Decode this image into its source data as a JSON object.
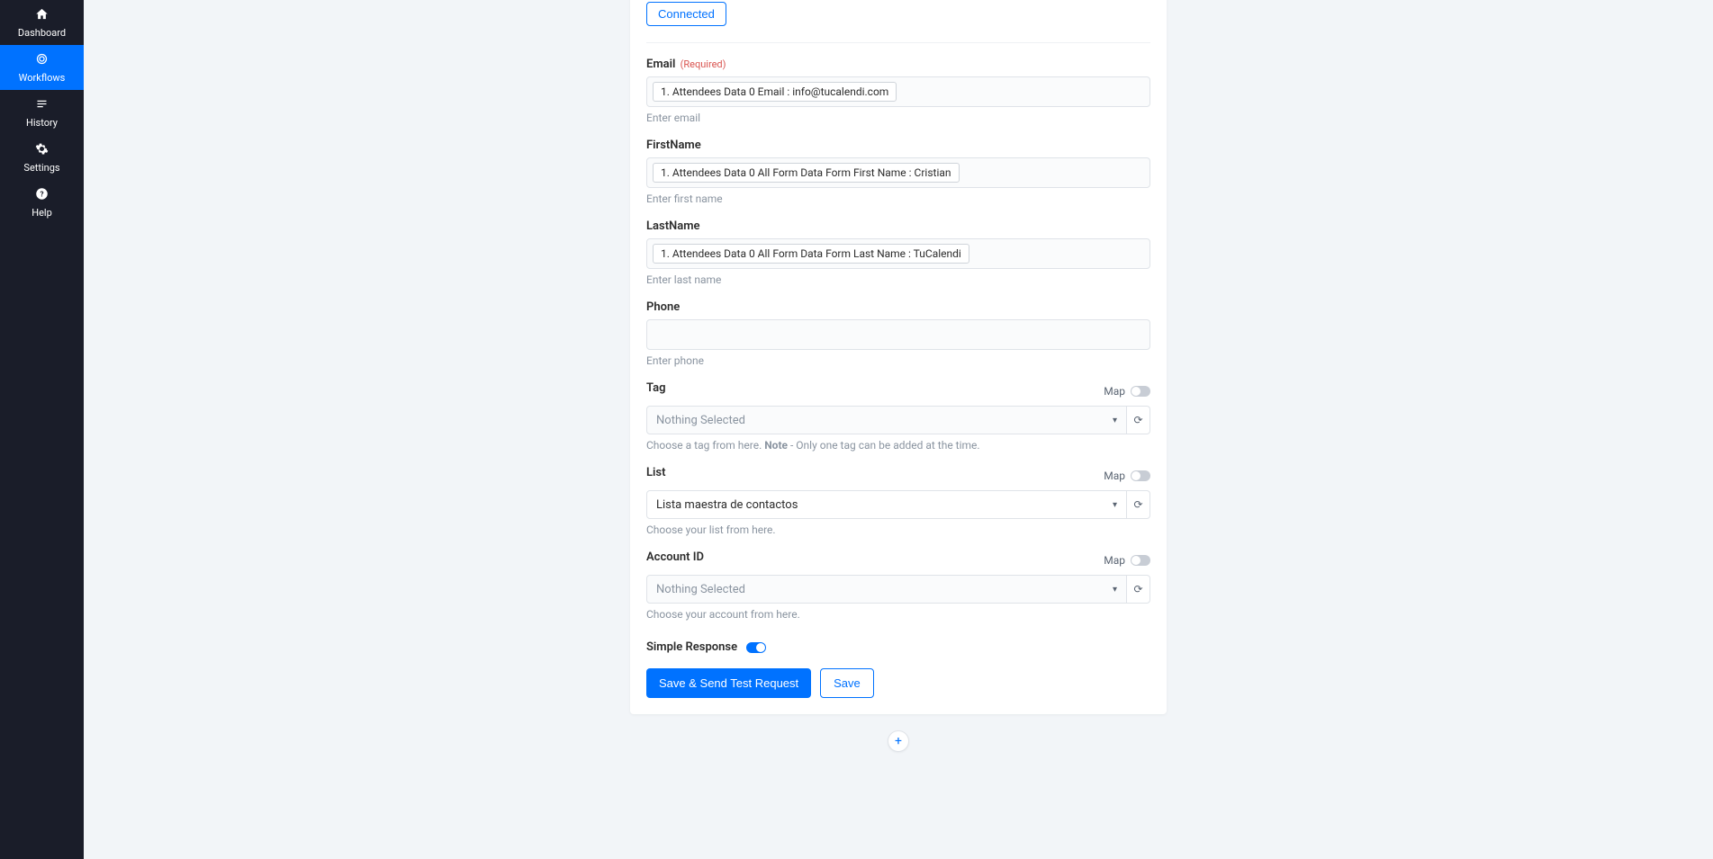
{
  "sidebar": {
    "items": [
      {
        "label": "Dashboard"
      },
      {
        "label": "Workflows"
      },
      {
        "label": "History"
      },
      {
        "label": "Settings"
      },
      {
        "label": "Help"
      }
    ]
  },
  "connected_label": "Connected",
  "fields": {
    "email": {
      "label": "Email",
      "required_label": "(Required)",
      "token": "1. Attendees Data 0 Email : info@tucalendi.com",
      "help": "Enter email"
    },
    "firstname": {
      "label": "FirstName",
      "token": "1. Attendees Data 0 All Form Data Form First Name : Cristian",
      "help": "Enter first name"
    },
    "lastname": {
      "label": "LastName",
      "token": "1. Attendees Data 0 All Form Data Form Last Name : TuCalendi",
      "help": "Enter last name"
    },
    "phone": {
      "label": "Phone",
      "help": "Enter phone"
    },
    "tag": {
      "label": "Tag",
      "map_label": "Map",
      "placeholder": "Nothing Selected",
      "help_prefix": "Choose a tag from here. ",
      "help_note": "Note",
      "help_suffix": " - Only one tag can be added at the time."
    },
    "list": {
      "label": "List",
      "map_label": "Map",
      "value": "Lista maestra de contactos",
      "help": "Choose your list from here."
    },
    "account": {
      "label": "Account ID",
      "map_label": "Map",
      "placeholder": "Nothing Selected",
      "help": "Choose your account from here."
    }
  },
  "simple_response_label": "Simple Response",
  "buttons": {
    "save_send": "Save & Send Test Request",
    "save": "Save"
  }
}
